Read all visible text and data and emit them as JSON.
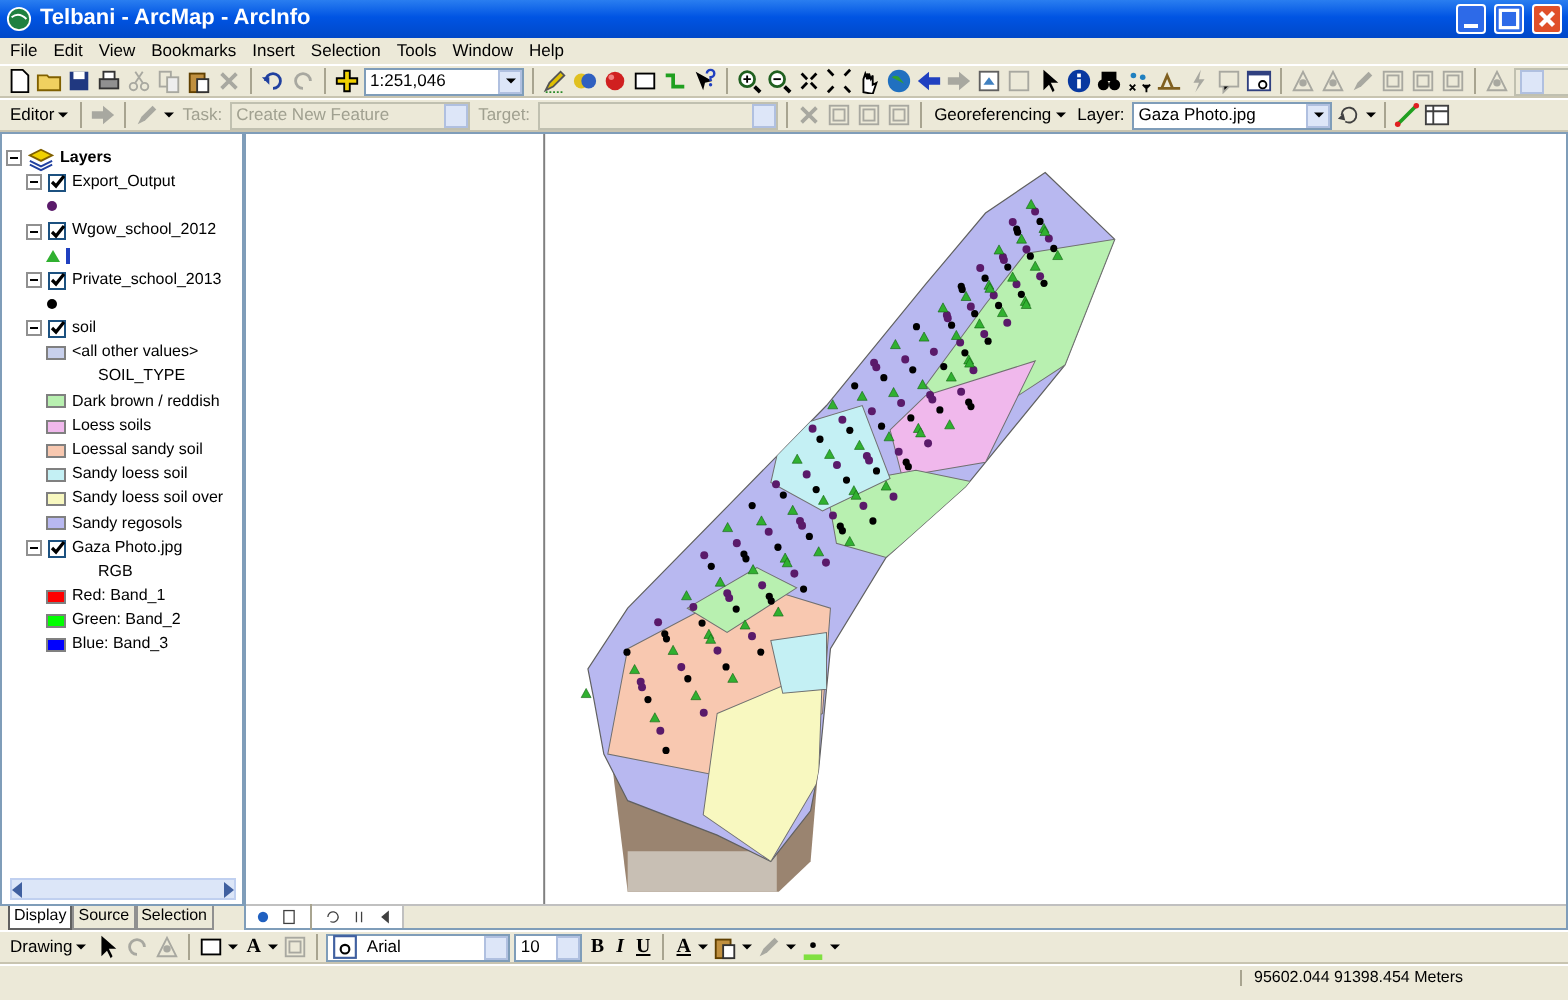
{
  "window": {
    "title": "Telbani - ArcMap - ArcInfo"
  },
  "menu": [
    "File",
    "Edit",
    "View",
    "Bookmarks",
    "Insert",
    "Selection",
    "Tools",
    "Window",
    "Help"
  ],
  "standard_toolbar": {
    "scale": "1:251,046"
  },
  "editor_toolbar": {
    "menu": "Editor",
    "task": {
      "label": "Task:",
      "value": "Create New Feature",
      "disabled": true
    },
    "target": {
      "label": "Target:",
      "disabled": true
    }
  },
  "georeferencing_toolbar": {
    "menu": "Georeferencing",
    "layer_label": "Layer:",
    "layer": "Gaza Photo.jpg"
  },
  "toc": {
    "root": "Layers",
    "expanded": true,
    "layers": [
      {
        "name": "Export_Output",
        "checked": true,
        "expanded": true,
        "legend": [
          {
            "kind": "point",
            "color": "#5a1a6a"
          }
        ]
      },
      {
        "name": "Wgow_school_2012",
        "checked": true,
        "expanded": true,
        "legend": [
          {
            "kind": "triangle",
            "color": "#30b030"
          },
          {
            "kind": "bar",
            "color": "#2040c0"
          }
        ]
      },
      {
        "name": "Private_school_2013",
        "checked": true,
        "expanded": true,
        "legend": [
          {
            "kind": "point",
            "color": "#000000"
          }
        ]
      },
      {
        "name": "soil",
        "checked": true,
        "expanded": true,
        "legend": [
          {
            "kind": "patch",
            "label": "<all other values>",
            "color": "#c8d0ec"
          },
          {
            "kind": "heading",
            "label": "SOIL_TYPE"
          },
          {
            "kind": "patch",
            "label": "Dark brown / reddish",
            "color": "#b8f0b0"
          },
          {
            "kind": "patch",
            "label": "Loess soils",
            "color": "#f0b8ec"
          },
          {
            "kind": "patch",
            "label": "Loessal sandy soil",
            "color": "#f8c8b0"
          },
          {
            "kind": "patch",
            "label": "Sandy loess soil",
            "color": "#c4f0f4"
          },
          {
            "kind": "patch",
            "label": "Sandy loess soil over",
            "color": "#f8f8c0"
          },
          {
            "kind": "patch",
            "label": "Sandy regosols",
            "color": "#b8b8f0"
          }
        ]
      },
      {
        "name": "Gaza Photo.jpg",
        "checked": true,
        "expanded": true,
        "legend": [
          {
            "kind": "heading",
            "label": "RGB"
          },
          {
            "kind": "patch",
            "label": "Red:   Band_1",
            "color": "#ff0000"
          },
          {
            "kind": "patch",
            "label": "Green: Band_2",
            "color": "#00ff00"
          },
          {
            "kind": "patch",
            "label": "Blue:   Band_3",
            "color": "#0000ff"
          }
        ]
      }
    ],
    "tabs": [
      {
        "label": "Display",
        "selected": true
      },
      {
        "label": "Source",
        "selected": false
      },
      {
        "label": "Selection",
        "selected": false
      }
    ]
  },
  "drawing_toolbar": {
    "menu": "Drawing",
    "text_tool": "A",
    "font": "Arial",
    "size": "10",
    "styles": [
      "B",
      "I",
      "U"
    ],
    "font_color": "A"
  },
  "status_bar": {
    "coordinates": "95602.044  91398.454 Meters"
  }
}
